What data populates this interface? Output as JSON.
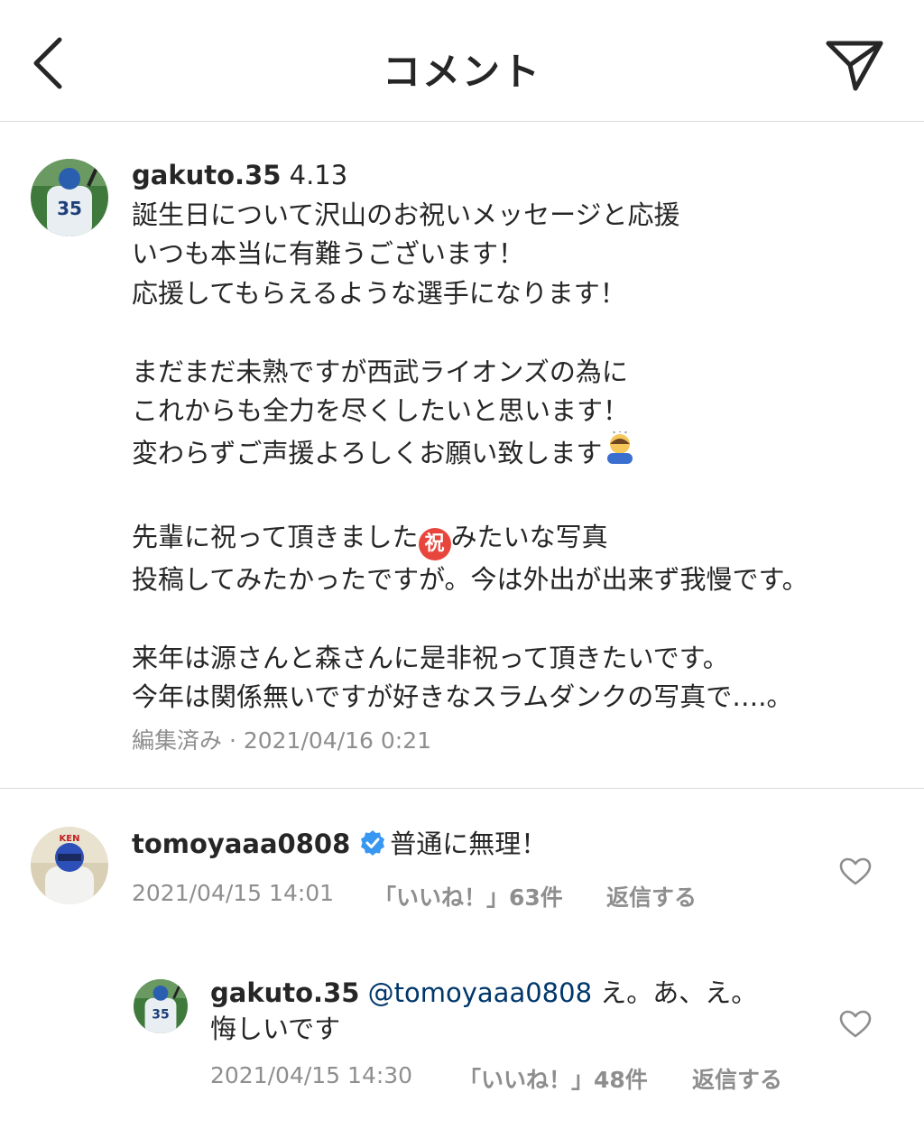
{
  "header": {
    "title": "コメント",
    "back_icon": "chevron-left-icon",
    "share_icon": "paper-plane-icon"
  },
  "caption": {
    "username": "gakuto.35",
    "date_tag": "4.13",
    "lines": [
      "誕生日について沢山のお祝いメッセージと応援",
      "いつも本当に有難うございます！",
      "応援してもらえるような選手になります！",
      "",
      "まだまだ未熟ですが西武ライオンズの為に",
      "これからも全力を尽くしたいと思います！",
      "変わらずご声援よろしくお願い致します",
      "",
      "先輩に祝って頂きました",
      "みたいな写真",
      "投稿してみたかったですが。今は外出が出来ず我慢です。",
      "",
      "来年は源さんと森さんに是非祝って頂きたいです。",
      "今年は関係無いですが好きなスラムダンクの写真で….。"
    ],
    "bow_emoji": "bowing-person-emoji",
    "iwai_emoji": "祝",
    "meta": "編集済み · 2021/04/16 0:21"
  },
  "comments": [
    {
      "username": "tomoyaaa0808",
      "verified_icon": "verified-badge-icon",
      "text": "普通に無理！",
      "timestamp": "2021/04/15 14:01",
      "likes": "「いいね！」63件",
      "reply_label": "返信する",
      "heart_icon": "heart-outline-icon"
    }
  ],
  "reply": {
    "username": "gakuto.35",
    "mention": "@tomoyaaa0808",
    "text_line1": "え。あ、え。",
    "text_line2": "悔しいです",
    "timestamp": "2021/04/15 14:30",
    "likes": "「いいね！」48件",
    "reply_label": "返信する",
    "heart_icon": "heart-outline-icon"
  },
  "colors": {
    "text": "#262626",
    "secondary": "#8e8e8e",
    "mention": "#00376b",
    "verified": "#3897f0",
    "divider": "#dbdbdb"
  }
}
